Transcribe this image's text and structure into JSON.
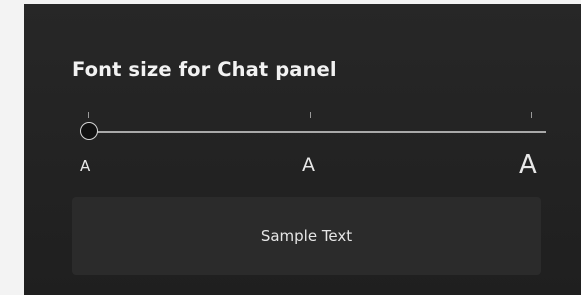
{
  "settings": {
    "title": "Font size for Chat panel",
    "slider": {
      "value_fraction": 0,
      "labels": [
        "A",
        "A",
        "A"
      ]
    },
    "sample_text": "Sample Text"
  },
  "colors": {
    "panel_bg": "#242424",
    "text": "#f2f2f2",
    "track": "#a9a9a9",
    "thumb_border": "#d4d4d4"
  }
}
